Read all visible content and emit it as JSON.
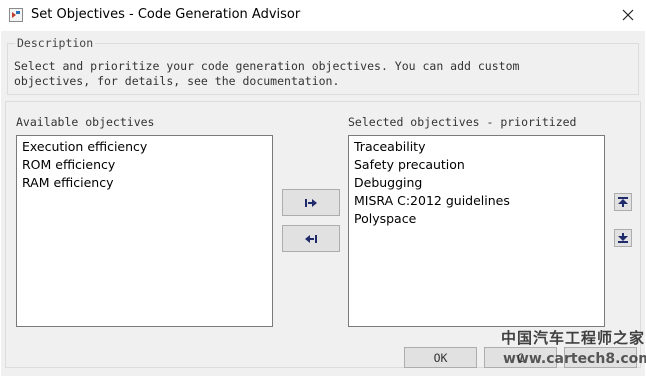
{
  "window": {
    "title": "Set Objectives - Code Generation Advisor",
    "icon": "simulink-app-icon",
    "close_icon": "close-icon"
  },
  "description": {
    "legend": "Description",
    "line1": "Select and prioritize your code generation objectives. You can add custom",
    "line2": "objectives, for details, see the documentation."
  },
  "available": {
    "label": "Available objectives",
    "items": [
      "Execution efficiency",
      "ROM efficiency",
      "RAM efficiency"
    ]
  },
  "selected": {
    "label": "Selected objectives - prioritized",
    "items": [
      "Traceability",
      "Safety precaution",
      "Debugging",
      "MISRA C:2012 guidelines",
      "Polyspace"
    ]
  },
  "transfer": {
    "add_icon": "arrow-right-bar-icon",
    "remove_icon": "arrow-left-bar-icon"
  },
  "priority": {
    "up_icon": "move-up-icon",
    "down_icon": "move-down-icon"
  },
  "footer": {
    "ok_label": "OK",
    "cancel_label": "C"
  },
  "watermark": {
    "cn_text": "中国汽车工程师之家",
    "en_text": "www.cartech8.com"
  },
  "colors": {
    "client_bg": "#f0f0f0",
    "icon_navy": "#1f2a6b"
  }
}
